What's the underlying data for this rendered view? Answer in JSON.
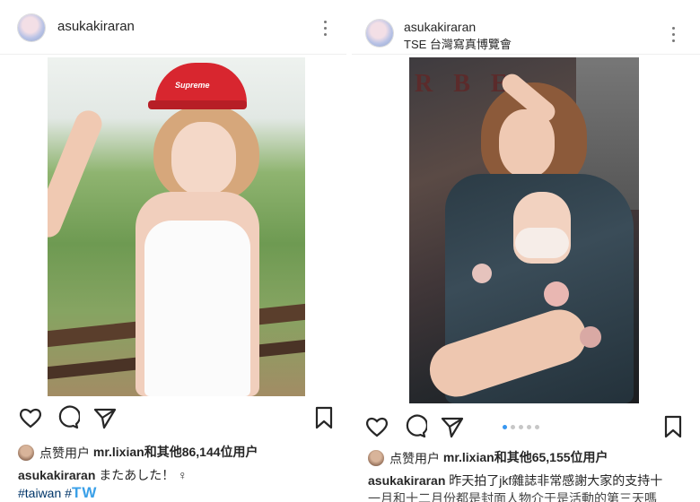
{
  "left_post": {
    "username": "asukakiraran",
    "photo_text": "Supreme",
    "likes_label": "点赞用户",
    "likes_user": "mr.lixian",
    "likes_and_others": "和其他",
    "likes_count": "86,144",
    "likes_suffix": "位用户",
    "caption_user": "asukakiraran",
    "caption_text": "またあした！ ♀",
    "hashtag_line": "#taiwan #",
    "hashtag_big": "TW"
  },
  "right_post": {
    "username": "asukakiraran",
    "location": "TSE 台灣寫真博覽會",
    "photo_text": "R B E",
    "likes_label": "点赞用户",
    "likes_user": "mr.lixian",
    "likes_and_others": "和其他",
    "likes_count": "65,155",
    "likes_suffix": "位用户",
    "caption_user": "asukakiraran",
    "caption_text": "昨天拍了jkf雜誌非常感謝大家的支持十",
    "caption_line2": "一月和十二月份都是封面人物介于是活動的第三天嗎",
    "carousel": {
      "count": 5,
      "active": 0
    }
  },
  "icons": {
    "like": "heart-icon",
    "comment": "comment-icon",
    "share": "paper-plane-icon",
    "save": "bookmark-icon",
    "more": "more-dots-icon"
  },
  "colors": {
    "text": "#262626",
    "hashtag": "#003569",
    "accent": "#3897f0",
    "cap_red": "#d8262f"
  }
}
